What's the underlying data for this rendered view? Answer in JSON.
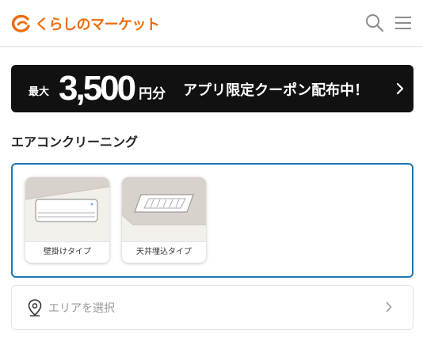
{
  "header": {
    "logo_text": "くらしのマーケット",
    "brand_color": "#ef6c0a",
    "search_icon": "search-icon",
    "menu_icon": "hamburger-menu-icon"
  },
  "banner": {
    "prefix": "最大",
    "amount": "3,500",
    "unit": "円分",
    "message": "アプリ限定クーポン配布中！",
    "chevron_icon": "chevron-right-icon"
  },
  "section_title": "エアコンクリーニング",
  "types": [
    {
      "label": "壁掛けタイプ",
      "icon": "wall-mounted-ac-icon"
    },
    {
      "label": "天井埋込タイプ",
      "icon": "ceiling-embedded-ac-icon"
    }
  ],
  "selection_border_color": "#1f77b4",
  "area": {
    "placeholder": "エリアを選択",
    "pin_icon": "location-pin-icon",
    "chevron_icon": "chevron-right-icon"
  }
}
